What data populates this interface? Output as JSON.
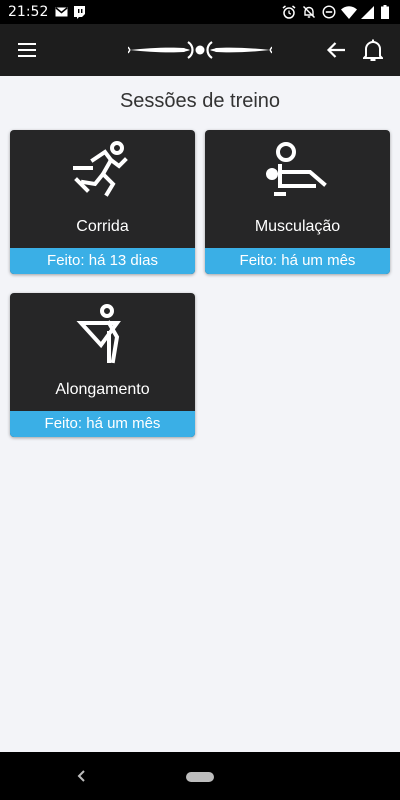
{
  "status_bar": {
    "time": "21:52",
    "icons": [
      "gmail-icon",
      "twitch-icon",
      "alarm-icon",
      "notifications-off-icon",
      "do-not-disturb-icon",
      "wifi-icon",
      "cellular-icon",
      "battery-icon"
    ]
  },
  "app_bar": {
    "menu_icon": "menu-icon",
    "logo": "app-logo",
    "back_icon": "arrow-back-icon",
    "notifications_icon": "bell-icon"
  },
  "page": {
    "title": "Sessões de treino"
  },
  "sessions": [
    {
      "name": "Corrida",
      "status": "Feito: há 13 dias",
      "icon": "running-icon"
    },
    {
      "name": "Musculação",
      "status": "Feito: há um mês",
      "icon": "weightlifting-icon"
    },
    {
      "name": "Alongamento",
      "status": "Feito: há um mês",
      "icon": "stretching-icon"
    }
  ],
  "colors": {
    "accent": "#3aafe6",
    "card": "#262627",
    "app_bar": "#1d1d1d",
    "background": "#f3f4f8"
  }
}
